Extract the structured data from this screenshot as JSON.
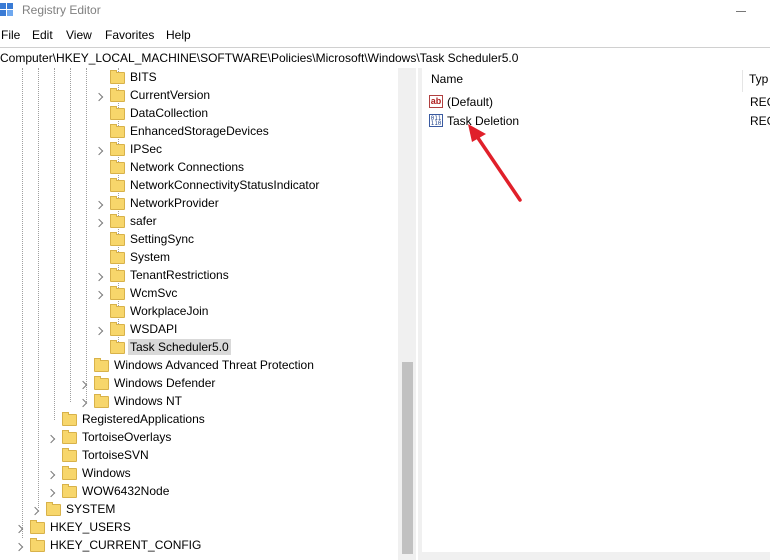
{
  "window": {
    "title": "Registry Editor"
  },
  "menu": [
    "File",
    "Edit",
    "View",
    "Favorites",
    "Help"
  ],
  "address": "Computer\\HKEY_LOCAL_MACHINE\\SOFTWARE\\Policies\\Microsoft\\Windows\\Task Scheduler5.0",
  "tree": [
    {
      "label": "BITS"
    },
    {
      "label": "CurrentVersion"
    },
    {
      "label": "DataCollection"
    },
    {
      "label": "EnhancedStorageDevices"
    },
    {
      "label": "IPSec"
    },
    {
      "label": "Network Connections"
    },
    {
      "label": "NetworkConnectivityStatusIndicator"
    },
    {
      "label": "NetworkProvider"
    },
    {
      "label": "safer"
    },
    {
      "label": "SettingSync"
    },
    {
      "label": "System"
    },
    {
      "label": "TenantRestrictions"
    },
    {
      "label": "WcmSvc"
    },
    {
      "label": "WorkplaceJoin"
    },
    {
      "label": "WSDAPI"
    },
    {
      "label": "Task Scheduler5.0"
    },
    {
      "label": "Windows Advanced Threat Protection"
    },
    {
      "label": "Windows Defender"
    },
    {
      "label": "Windows NT"
    },
    {
      "label": "RegisteredApplications"
    },
    {
      "label": "TortoiseOverlays"
    },
    {
      "label": "TortoiseSVN"
    },
    {
      "label": "Windows"
    },
    {
      "label": "WOW6432Node"
    },
    {
      "label": "SYSTEM"
    },
    {
      "label": "HKEY_USERS"
    },
    {
      "label": "HKEY_CURRENT_CONFIG"
    }
  ],
  "list": {
    "columns": [
      "Name",
      "Typ"
    ],
    "rows": [
      {
        "name": "(Default)",
        "type": "REG",
        "icon": "string-value-icon"
      },
      {
        "name": "Task Deletion",
        "type": "REG",
        "icon": "binary-value-icon"
      }
    ]
  },
  "annotation": {
    "arrow_color": "#e0202a"
  }
}
